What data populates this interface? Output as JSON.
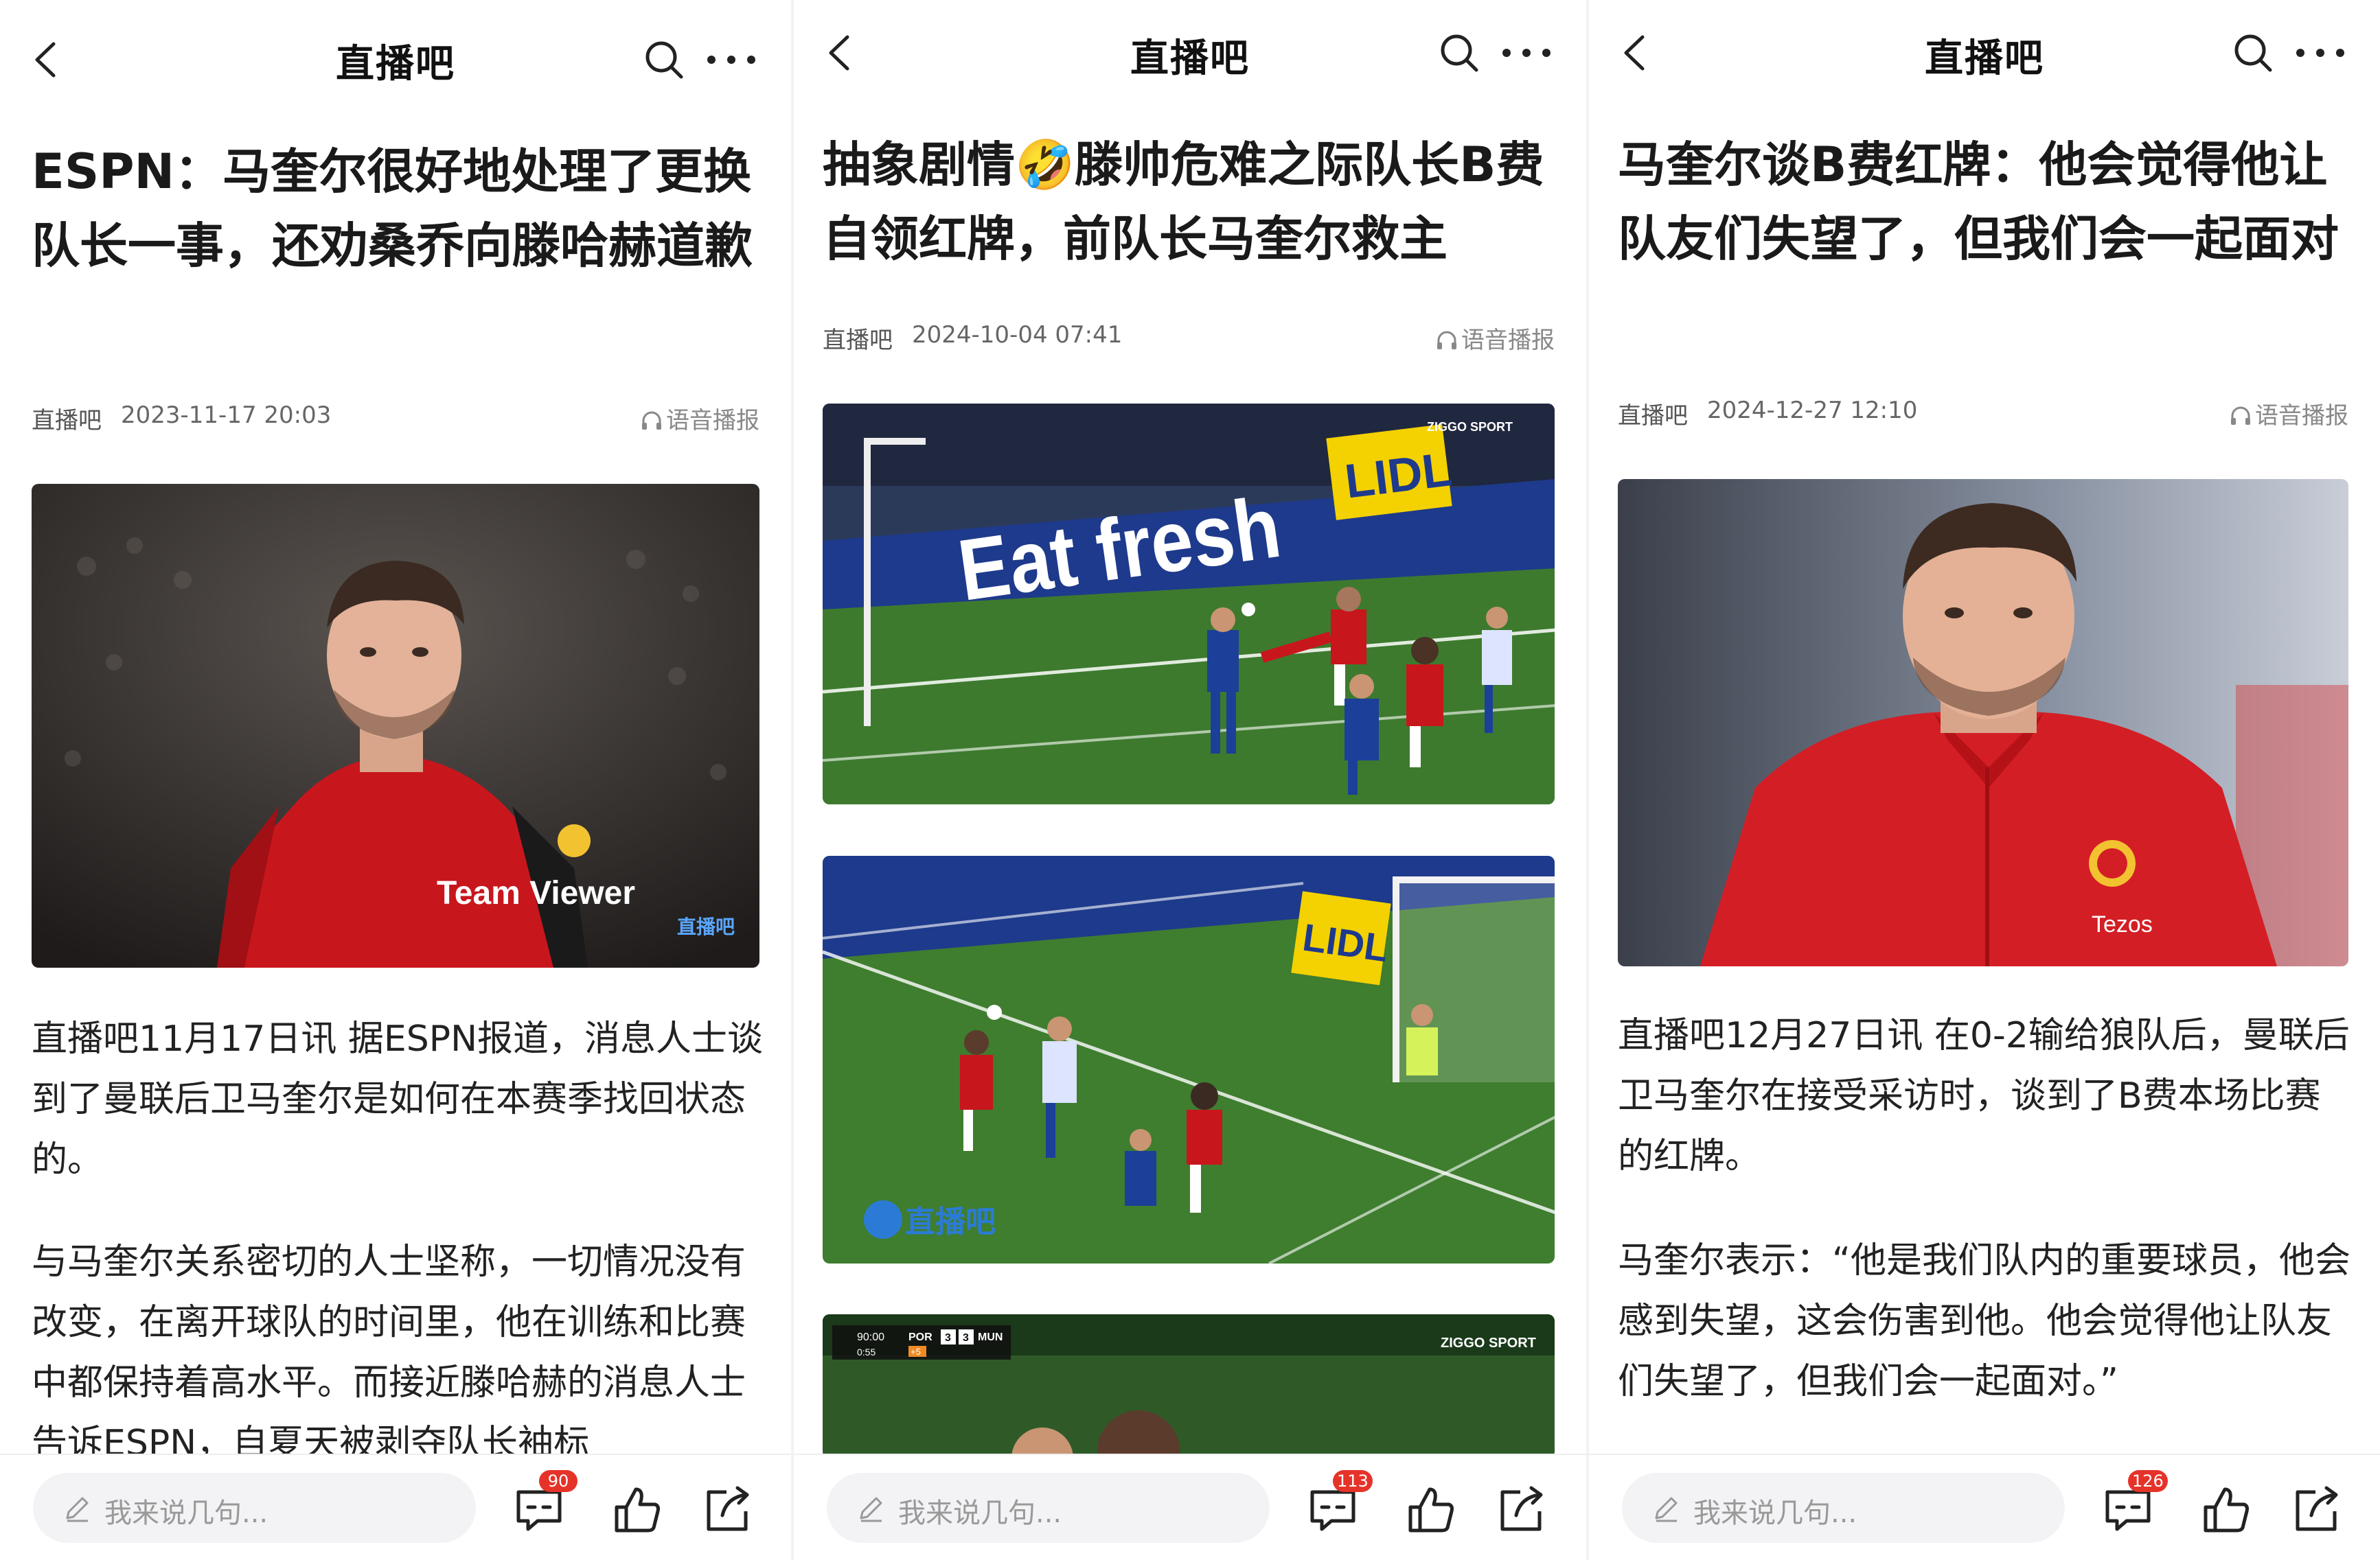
{
  "panels": [
    {
      "nav_title": "直播吧",
      "headline": "ESPN：马奎尔很好地处理了更换队长一事，还劝桑乔向滕哈赫道歉",
      "source": "直播吧",
      "date": "2023-11-17 20:03",
      "tts_label": "语音播报",
      "watermark": "直播吧",
      "jersey_text": "Team Viewer",
      "paragraphs": [
        "直播吧11月17日讯 据ESPN报道，消息人士谈到了曼联后卫马奎尔是如何在本赛季找回状态的。",
        "与马奎尔关系密切的人士坚称，一切情况没有改变，在离开球队的时间里，他在训练和比赛中都保持着高水平。而接近滕哈赫的消息人士告诉ESPN，自夏天被剥夺队长袖标"
      ],
      "comment_placeholder": "我来说几句...",
      "comment_count": "90"
    },
    {
      "nav_title": "直播吧",
      "headline": "抽象剧情🤣滕帅危难之际队长B费自领红牌，前队长马奎尔救主",
      "source": "直播吧",
      "date": "2024-10-04 07:41",
      "tts_label": "语音播报",
      "board_text_1": "Eat fresh",
      "board_text_2": "LIDL",
      "broadcaster": "ZIGGO SPORT",
      "watermark": "直播吧",
      "scorebar": {
        "time": "90:00",
        "extra": "0:55",
        "home": "POR",
        "home_score": "3",
        "away_score": "3",
        "away": "MUN",
        "added": "+5"
      },
      "comment_placeholder": "我来说几句...",
      "comment_count": "113"
    },
    {
      "nav_title": "直播吧",
      "headline": "马奎尔谈B费红牌：他会觉得他让队友们失望了，但我们会一起面对",
      "source": "直播吧",
      "date": "2024-12-27 12:10",
      "tts_label": "语音播报",
      "jacket_text": "Tezos",
      "paragraphs": [
        "直播吧12月27日讯 在0-2输给狼队后，曼联后卫马奎尔在接受采访时，谈到了B费本场比赛的红牌。",
        "马奎尔表示：“他是我们队内的重要球员，他会感到失望，这会伤害到他。他会觉得他让队友们失望了，但我们会一起面对。”"
      ],
      "comment_placeholder": "我来说几句...",
      "comment_count": "126"
    }
  ],
  "icons": {
    "back": "back-arrow-icon",
    "search": "search-icon",
    "more": "more-dots-icon",
    "headphones": "headphones-icon",
    "pencil": "pencil-icon",
    "comment": "comment-icon",
    "like": "thumbs-up-icon",
    "share": "share-icon"
  },
  "colors": {
    "badge": "#e5332a",
    "kit_red": "#c8161d",
    "pitch": "#3d7a2e",
    "board_blue": "#1e3a8c"
  }
}
